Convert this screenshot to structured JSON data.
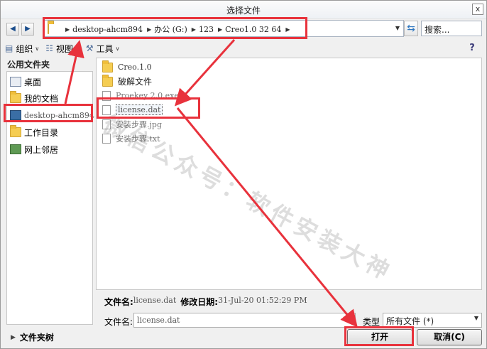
{
  "window": {
    "title": "选择文件",
    "close_glyph": "x"
  },
  "nav": {
    "back_glyph": "◀",
    "forward_glyph": "▶"
  },
  "address": {
    "crumbs": [
      "desktop-ahcm894",
      "办公 (G:)",
      "123",
      "Creo1.0 32 64"
    ],
    "separator_glyph": "▶",
    "dropdown_glyph": "▼",
    "refresh_glyph": "⇆"
  },
  "search": {
    "placeholder": "搜索..."
  },
  "toolbar": {
    "organize": "组织",
    "view": "视图",
    "tools": "工具",
    "chevron_glyph": "∨",
    "help_glyph": "?"
  },
  "sidebar": {
    "heading": "公用文件夹",
    "items": [
      {
        "label": "桌面",
        "icon": "desktop-icon"
      },
      {
        "label": "我的文档",
        "icon": "documents-icon"
      },
      {
        "label": "desktop-ahcm894",
        "icon": "computer-icon"
      },
      {
        "label": "工作目录",
        "icon": "working-directory-icon"
      },
      {
        "label": "网上邻居",
        "icon": "network-icon"
      }
    ]
  },
  "files": [
    {
      "name": "Creo.1.0",
      "type": "folder"
    },
    {
      "name": "破解文件",
      "type": "folder"
    },
    {
      "name": "Proekey 2.0.exe",
      "type": "file"
    },
    {
      "name": "license.dat",
      "type": "file",
      "selected": true
    },
    {
      "name": "安装步骤.jpg",
      "type": "file"
    },
    {
      "name": "安装步骤.txt",
      "type": "file"
    }
  ],
  "info": {
    "name_label": "文件名:",
    "name_value": "license.dat",
    "date_label": "修改日期:",
    "date_value": "31-Jul-20 01:52:29 PM"
  },
  "filename_row": {
    "label": "文件名:",
    "value": "license.dat",
    "type_label": "类型",
    "type_value": "所有文件 (*)"
  },
  "bottom": {
    "folder_tree": "文件夹树",
    "tree_glyph": "▶",
    "open_button": "打开",
    "cancel_button": "取消(C)"
  },
  "watermark": "微信公众号：软件安装大神",
  "colors": {
    "annotation": "#e8323c",
    "folder": "#f5cd52"
  }
}
